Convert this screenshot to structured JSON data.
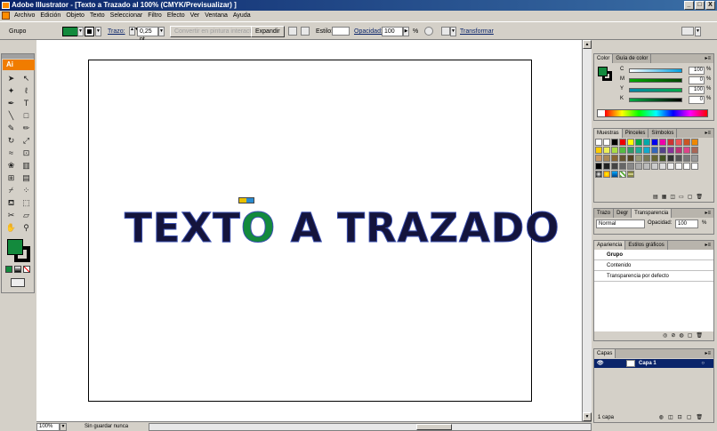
{
  "window": {
    "title": "Adobe Illustrator - [Texto a Trazado al 100% (CMYK/Previsualizar) ]",
    "buttons": [
      "_",
      "□",
      "X"
    ]
  },
  "menu": [
    "Archivo",
    "Edición",
    "Objeto",
    "Texto",
    "Seleccionar",
    "Filtro",
    "Efecto",
    "Ver",
    "Ventana",
    "Ayuda"
  ],
  "controlbar": {
    "selection": "Grupo",
    "stroke_label": "Trazo:",
    "stroke_value": "0,25 pt",
    "live_paint": "Convertir en pintura interactiva",
    "expand": "Expandir",
    "style_label": "Estilo:",
    "opacity_label": "Opacidad:",
    "opacity_value": "100",
    "pct": "%",
    "transform": "Transformar"
  },
  "tools": {
    "logo": "Ai",
    "fill_color": "#138a3d",
    "stroke_color": "#000000"
  },
  "canvas": {
    "text_before": "TEXT",
    "text_accent": "O",
    "text_after": " A TRAZADO",
    "accent_color": "#138a3d",
    "text_color": "#14143c"
  },
  "statusbar": {
    "zoom": "100%",
    "status": "Sin guardar nunca"
  },
  "color_panel": {
    "tabs": [
      "Color",
      "Guía de color"
    ],
    "channels": [
      {
        "label": "C",
        "value": "100",
        "pct": "%"
      },
      {
        "label": "M",
        "value": "0",
        "pct": "%"
      },
      {
        "label": "Y",
        "value": "100",
        "pct": "%"
      },
      {
        "label": "K",
        "value": "0",
        "pct": "%"
      }
    ]
  },
  "swatches_panel": {
    "tabs": [
      "Muestras",
      "Pinceles",
      "Símbolos"
    ]
  },
  "transparency_panel": {
    "tabs": [
      "Trazo",
      "Degr",
      "Transparencia"
    ],
    "mode": "Normal",
    "opacity_label": "Opacidad:",
    "opacity_value": "100",
    "pct": "%"
  },
  "appearance_panel": {
    "tabs": [
      "Apariencia",
      "Estilos gráficos"
    ],
    "rows": [
      "Grupo",
      "Contenido",
      "Transparencia por defecto"
    ]
  },
  "layers_panel": {
    "tabs": [
      "Capas"
    ],
    "layer": "Capa 1",
    "footer": "1 capa"
  }
}
